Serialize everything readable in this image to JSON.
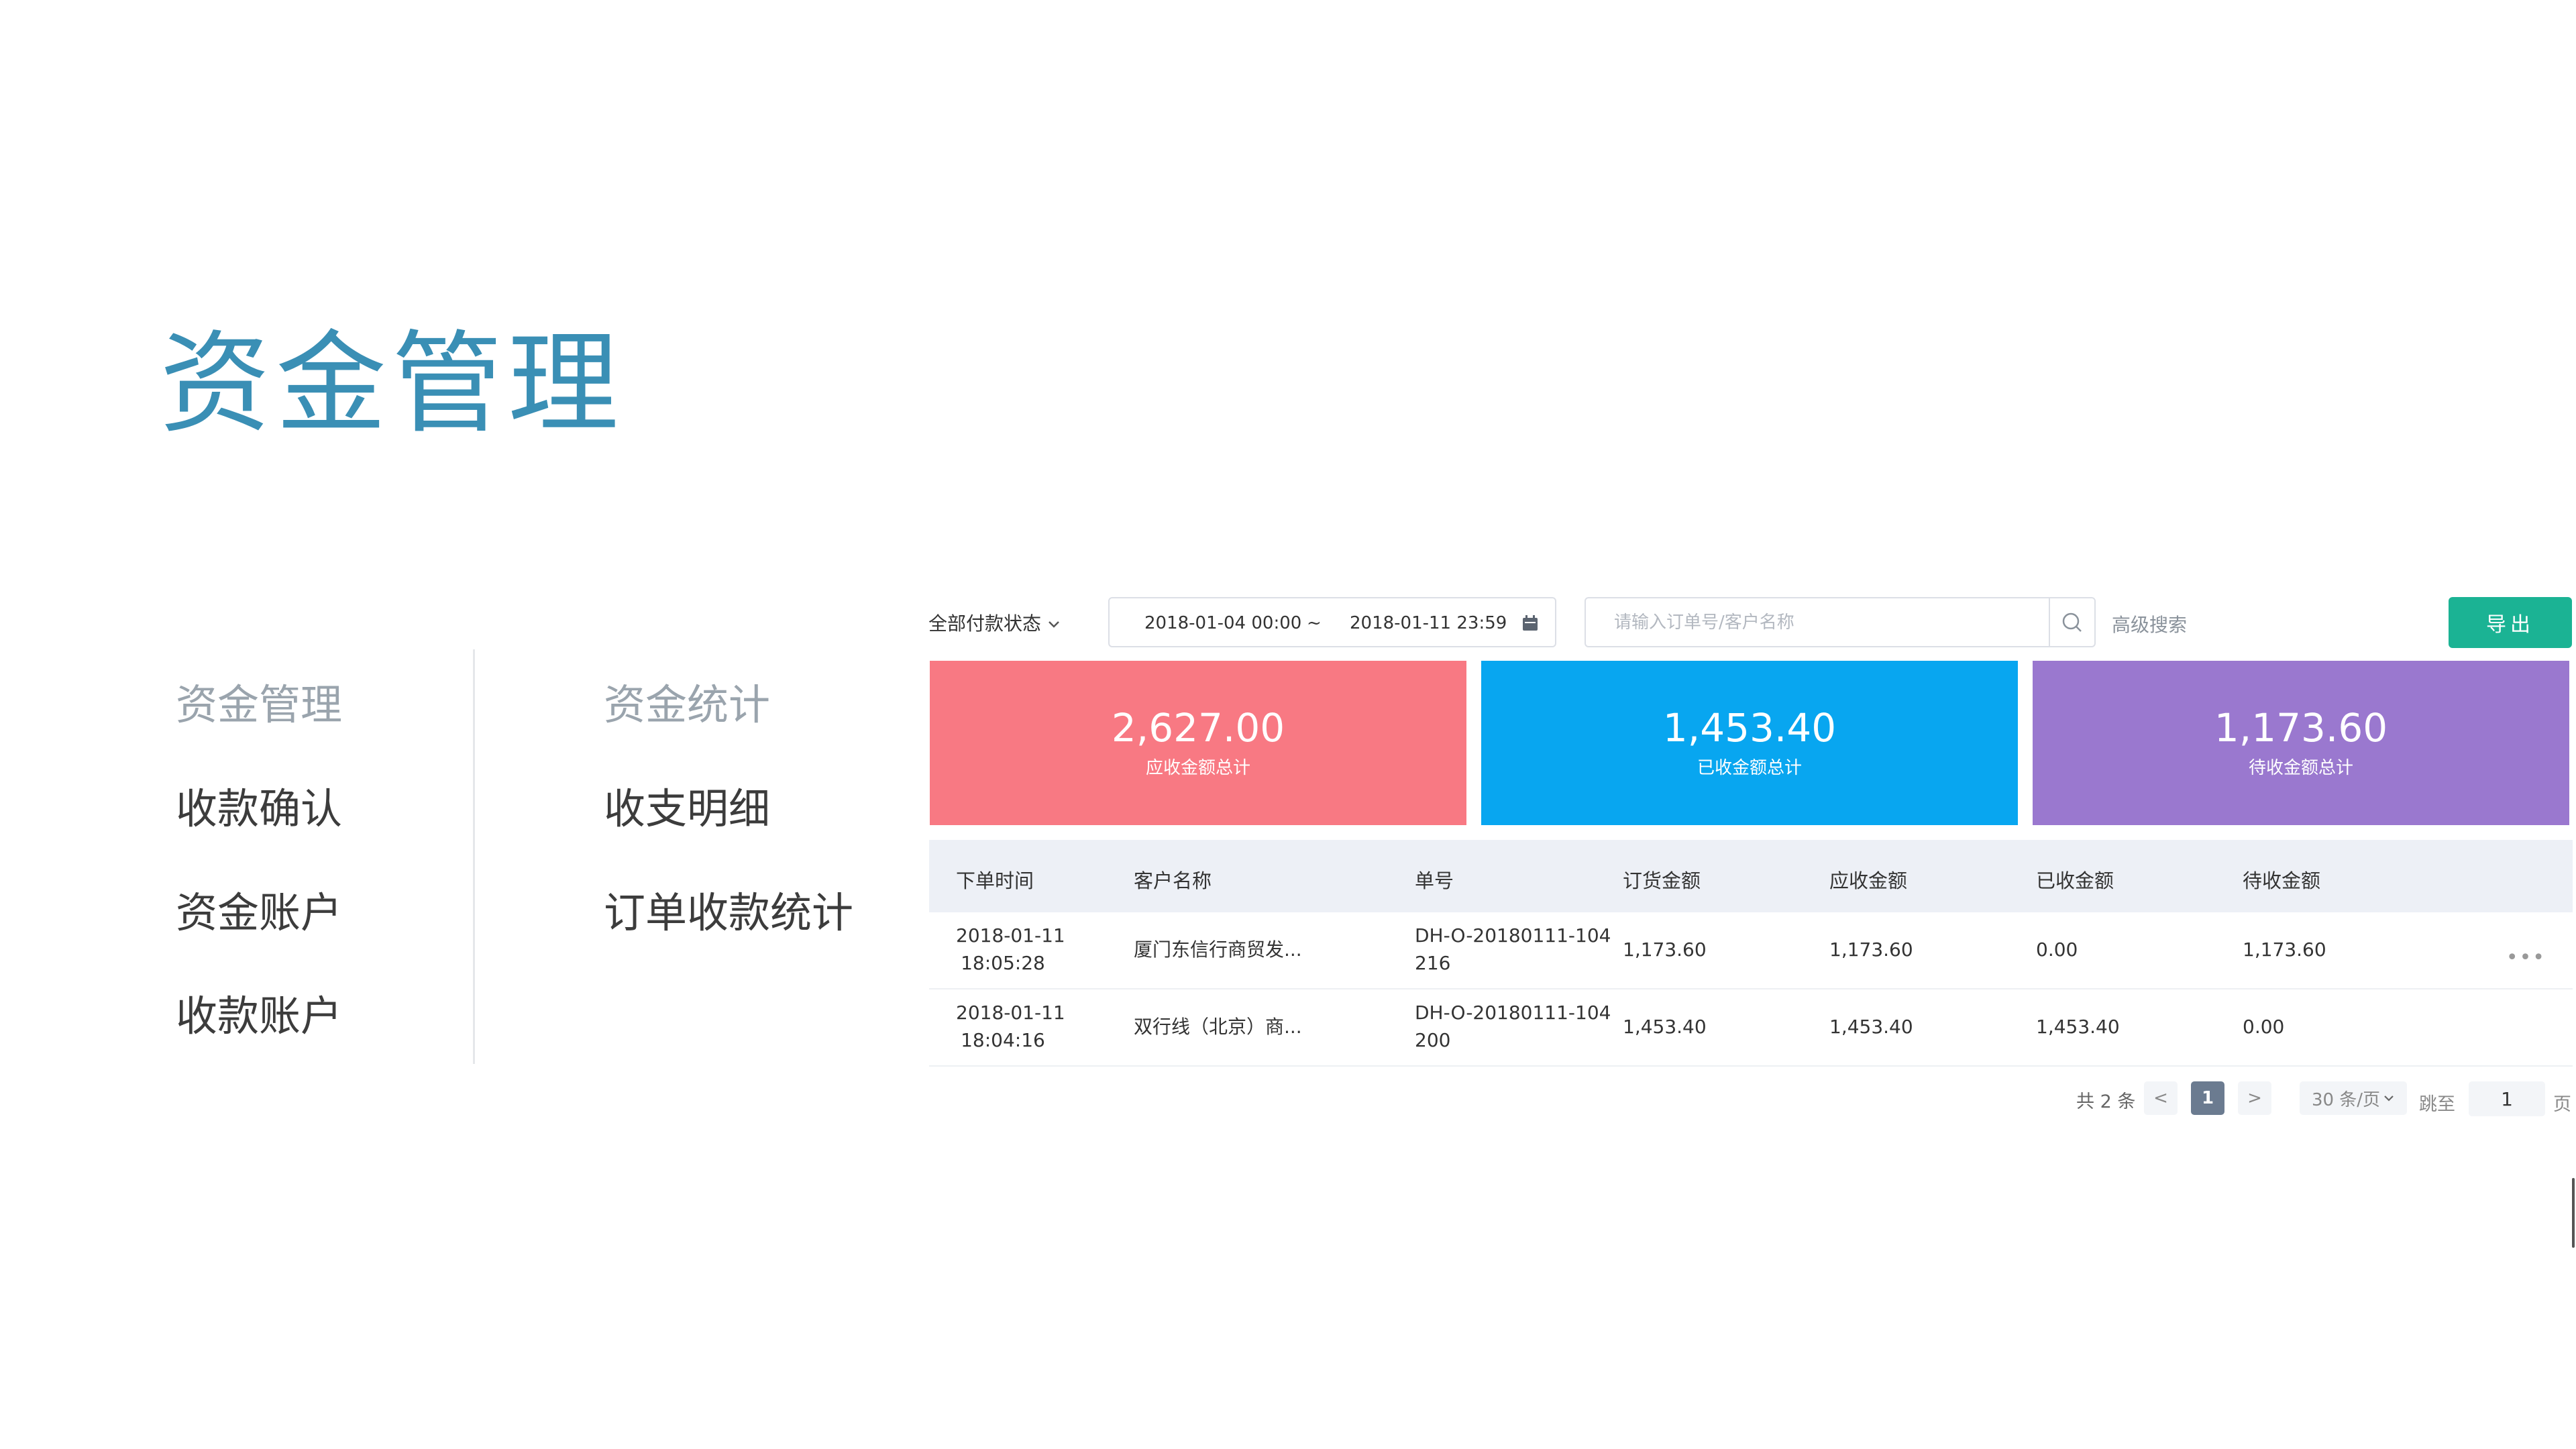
{
  "title": "资金管理",
  "menu": {
    "col1": [
      {
        "label": "资金管理",
        "muted": true
      },
      {
        "label": "收款确认",
        "muted": false
      },
      {
        "label": "资金账户",
        "muted": false
      },
      {
        "label": "收款账户",
        "muted": false
      }
    ],
    "col2": [
      {
        "label": "资金统计",
        "muted": true
      },
      {
        "label": "收支明细",
        "muted": false
      },
      {
        "label": "订单收款统计",
        "muted": false
      }
    ]
  },
  "toolbar": {
    "status_select": "全部付款状态",
    "date_start": "2018-01-04 00:00",
    "date_sep": "~",
    "date_end": "2018-01-11 23:59",
    "search_placeholder": "请输入订单号/客户名称",
    "advanced_search": "高级搜索",
    "export": "导出"
  },
  "cards": [
    {
      "value": "2,627.00",
      "label": "应收金额总计",
      "color": "#f87983"
    },
    {
      "value": "1,453.40",
      "label": "已收金额总计",
      "color": "#08a6f0"
    },
    {
      "value": "1,173.60",
      "label": "待收金额总计",
      "color": "#9a78cf"
    }
  ],
  "table": {
    "headers": [
      "下单时间",
      "客户名称",
      "单号",
      "订货金额",
      "应收金额",
      "已收金额",
      "待收金额"
    ],
    "rows": [
      {
        "date": "2018-01-11",
        "time": "18:05:28",
        "customer": "厦门东信行商贸发...",
        "no1": "DH-O-20180111-104",
        "no2": "216",
        "order_amount": "1,173.60",
        "receivable": "1,173.60",
        "received": "0.00",
        "pending": "1,173.60",
        "has_more": true
      },
      {
        "date": "2018-01-11",
        "time": "18:04:16",
        "customer": "双行线（北京）商...",
        "no1": "DH-O-20180111-104",
        "no2": "200",
        "order_amount": "1,453.40",
        "receivable": "1,453.40",
        "received": "1,453.40",
        "pending": "0.00",
        "has_more": false
      }
    ]
  },
  "pagination": {
    "total": "共 2 条",
    "prev": "<",
    "current": "1",
    "next": ">",
    "page_size": "30 条/页",
    "jump_label": "跳至",
    "jump_value": "1",
    "page_unit": "页"
  }
}
